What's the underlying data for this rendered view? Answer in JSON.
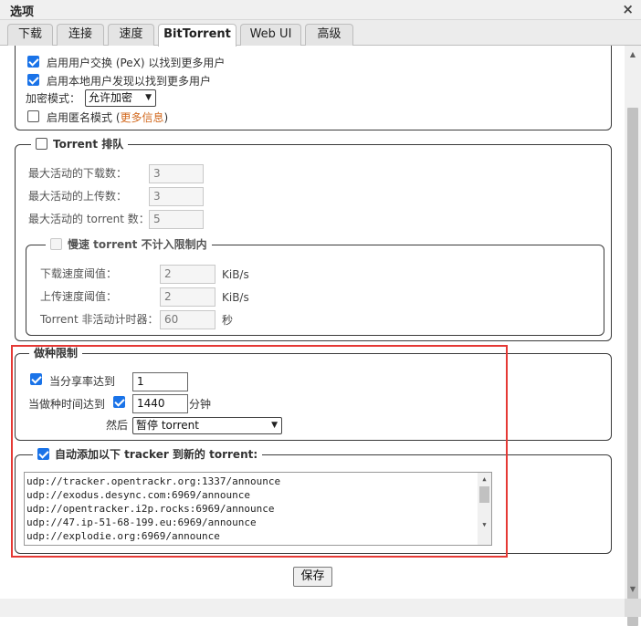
{
  "dialog": {
    "title": "选项",
    "close_glyph": "×"
  },
  "tabs": [
    "下载",
    "连接",
    "速度",
    "BitTorrent",
    "Web UI",
    "高级"
  ],
  "privacy": {
    "pex_label": "启用用户交换 (PeX) 以找到更多用户",
    "lsd_label": "启用本地用户发现以找到更多用户",
    "encryption_label": "加密模式：",
    "encryption_value": "允许加密",
    "anonymous_label": "启用匿名模式",
    "more_info_link": "更多信息",
    "paren_open": "(",
    "paren_close": ")"
  },
  "queue": {
    "legend": "Torrent 排队",
    "max_downloads_label": "最大活动的下载数：",
    "max_downloads_value": "3",
    "max_uploads_label": "最大活动的上传数：",
    "max_uploads_value": "3",
    "max_torrents_label": "最大活动的 torrent 数：",
    "max_torrents_value": "5",
    "slow": {
      "legend": "慢速 torrent 不计入限制内",
      "dl_label": "下载速度阈值：",
      "dl_value": "2",
      "dl_unit": "KiB/s",
      "ul_label": "上传速度阈值：",
      "ul_value": "2",
      "ul_unit": "KiB/s",
      "inactive_label": "Torrent 非活动计时器：",
      "inactive_value": "60",
      "inactive_unit": "秒"
    }
  },
  "seeding": {
    "legend": "做种限制",
    "ratio_label": "当分享率达到",
    "ratio_value": "1",
    "time_label": "当做种时间达到",
    "time_value": "1440",
    "time_unit": "分钟",
    "then_label": "然后",
    "then_value": "暂停 torrent"
  },
  "trackers": {
    "legend": "自动添加以下 tracker 到新的 torrent:",
    "lines": [
      "udp://tracker.opentrackr.org:1337/announce",
      "udp://exodus.desync.com:6969/announce",
      "udp://opentracker.i2p.rocks:6969/announce",
      "udp://47.ip-51-68-199.eu:6969/announce",
      "udp://explodie.org:6969/announce"
    ]
  },
  "save_label": "保存"
}
